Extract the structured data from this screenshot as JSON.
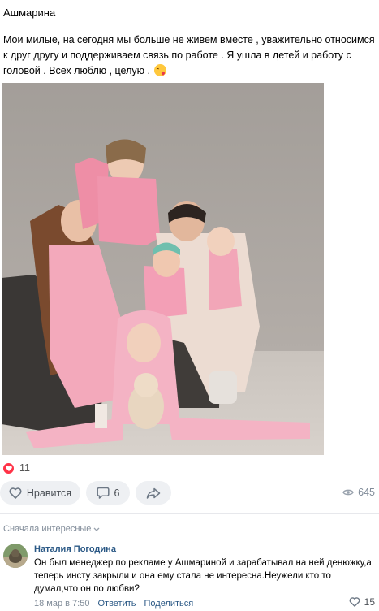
{
  "post": {
    "author": "Ашмарина",
    "text": "Мои милые, на сегодня мы больше не живем вместе , уважительно относимся к друг другу и поддерживаем связь по работе . Я ушла в детей и работу с головой . Всех люблю , целую .",
    "emoji": "face-blowing-kiss-icon",
    "photo": "family-photo"
  },
  "reactions": {
    "likes_count": "11"
  },
  "actions": {
    "like_label": "Нравится",
    "comments_count": "6",
    "views_count": "645"
  },
  "comments": {
    "sort_label": "Сначала интересные",
    "items": [
      {
        "author": "Наталия Погодина",
        "text": "Он был менеджер по рекламе у Ашмариной и зарабатывал на ней денюжку,а теперь инсту закрыли и она ему стала не интересна.Неужели кто то думал,что он по любви?",
        "date": "18 мар в 7:50",
        "reply_label": "Ответить",
        "share_label": "Поделиться",
        "likes": "15"
      }
    ]
  },
  "colors": {
    "link": "#2a5885",
    "meta": "#818c99",
    "like_red": "#ff3347",
    "button_bg": "#eef0f3"
  }
}
